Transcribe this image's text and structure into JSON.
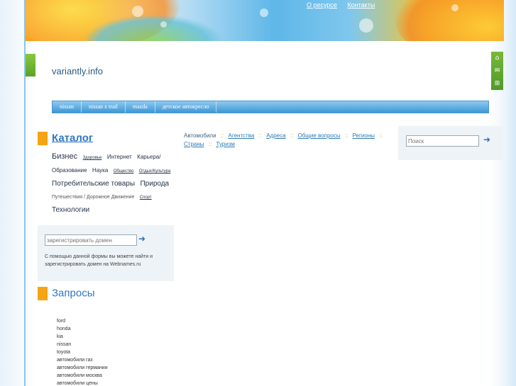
{
  "site": {
    "title": "variantly.info"
  },
  "top_links": [
    {
      "label": "О ресурсе"
    },
    {
      "label": "Контакты"
    }
  ],
  "right_icons": [
    "home-icon",
    "mail-icon",
    "sitemap-icon"
  ],
  "nav": [
    {
      "label": "nissan"
    },
    {
      "label": "nissan x trail"
    },
    {
      "label": "mazda"
    },
    {
      "label": "детское автокресло"
    }
  ],
  "catalog": {
    "title": "Каталог",
    "items": [
      {
        "label": "Бизнес",
        "size": 11
      },
      {
        "label": "Здоровье",
        "size": 6
      },
      {
        "label": "Интернет",
        "size": 8
      },
      {
        "label": "Карьера/Образование",
        "size": 8
      },
      {
        "label": "Наука",
        "size": 8
      },
      {
        "label": "Общество",
        "size": 6
      },
      {
        "label": "Отдых/Культура",
        "size": 6
      },
      {
        "label": "Потребительские товары",
        "size": 10
      },
      {
        "label": "Природа",
        "size": 10
      },
      {
        "label": "Путешествия / Дорожное Движение",
        "size": 7
      },
      {
        "label": "Спорт",
        "size": 6
      },
      {
        "label": "Технологии",
        "size": 10
      }
    ]
  },
  "domain_form": {
    "placeholder": "зарегистрировать домен",
    "submit_icon": "arrow-right-icon",
    "description": "С помощью данной формы вы можете найти и зарегистрировать домен на Webnames.ru"
  },
  "queries": {
    "title": "Запросы",
    "items": [
      "ford",
      "honda",
      "kia",
      "nissan",
      "toyota",
      "автомобили газ",
      "автомобили германии",
      "автомобили москва",
      "автомобили цены"
    ]
  },
  "breadcrumbs": {
    "first": "Автомобили",
    "separator": "::",
    "links": [
      "Агентства",
      "Адреса",
      "Общие вопросы",
      "Регионы",
      "Страны",
      "Туризм"
    ]
  },
  "search": {
    "placeholder": "Поиск",
    "submit_icon": "arrow-right-icon"
  },
  "colors": {
    "accent": "#2e77c1",
    "marker": "#f5a414",
    "nav": "#3d98d6",
    "green": "#5aa32a"
  }
}
